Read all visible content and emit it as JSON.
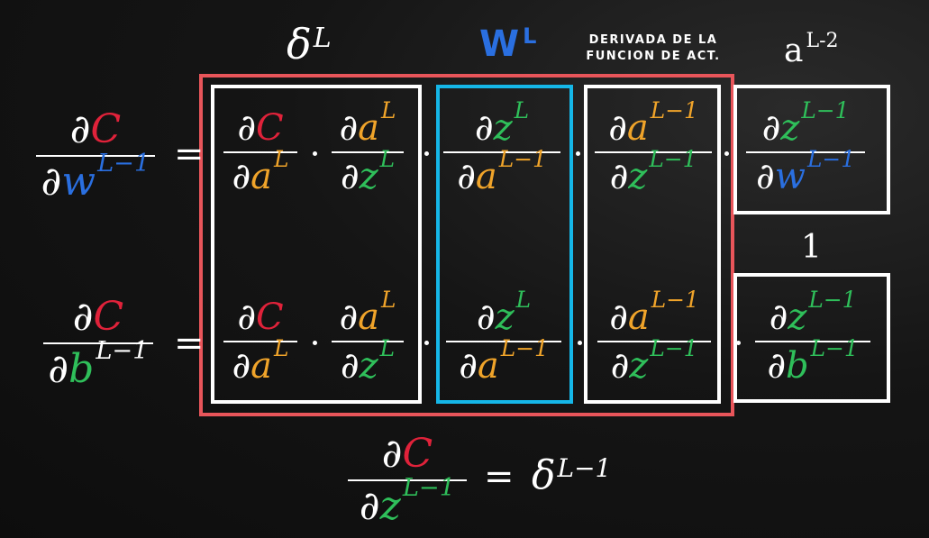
{
  "colors": {
    "C": "#e0223a",
    "a": "#f0a42a",
    "z": "#2fbf5a",
    "w": "#2a6fe0",
    "b": "#2fbf5a",
    "white": "#ffffff",
    "red_box": "#e8555a",
    "cyan_box": "#15b7e8"
  },
  "headers": {
    "delta_L": {
      "base": "δ",
      "sup": "L"
    },
    "W_L": {
      "base": "W",
      "sup": "L"
    },
    "act_deriv": [
      "DERIVADA DE LA",
      "FUNCION DE ACT."
    ],
    "a_L2": {
      "base": "a",
      "sup": "L-2"
    }
  },
  "one_label": "1",
  "row_w": {
    "lhs": {
      "num": [
        "∂",
        "C"
      ],
      "den": [
        "∂",
        "w",
        "L−1"
      ]
    },
    "terms": [
      {
        "num": [
          "∂",
          "C",
          ""
        ],
        "den": [
          "∂",
          "a",
          "L"
        ]
      },
      {
        "num": [
          "∂",
          "a",
          "L"
        ],
        "den": [
          "∂",
          "z",
          "L"
        ]
      },
      {
        "num": [
          "∂",
          "z",
          "L"
        ],
        "den": [
          "∂",
          "a",
          "L−1"
        ]
      },
      {
        "num": [
          "∂",
          "a",
          "L−1"
        ],
        "den": [
          "∂",
          "z",
          "L−1"
        ]
      },
      {
        "num": [
          "∂",
          "z",
          "L−1"
        ],
        "den": [
          "∂",
          "w",
          "L−1"
        ]
      }
    ]
  },
  "row_b": {
    "lhs": {
      "num": [
        "∂",
        "C"
      ],
      "den": [
        "∂",
        "b",
        "L−1"
      ]
    },
    "terms": [
      {
        "num": [
          "∂",
          "C",
          ""
        ],
        "den": [
          "∂",
          "a",
          "L"
        ]
      },
      {
        "num": [
          "∂",
          "a",
          "L"
        ],
        "den": [
          "∂",
          "z",
          "L"
        ]
      },
      {
        "num": [
          "∂",
          "z",
          "L"
        ],
        "den": [
          "∂",
          "a",
          "L−1"
        ]
      },
      {
        "num": [
          "∂",
          "a",
          "L−1"
        ],
        "den": [
          "∂",
          "z",
          "L−1"
        ]
      },
      {
        "num": [
          "∂",
          "z",
          "L−1"
        ],
        "den": [
          "∂",
          "b",
          "L−1"
        ]
      }
    ]
  },
  "bottom": {
    "num": [
      "∂",
      "C"
    ],
    "den": [
      "∂",
      "z",
      "L−1"
    ],
    "equals": "=",
    "rhs_base": "δ",
    "rhs_sup": "L−1"
  },
  "equals": "=",
  "dot": "·"
}
